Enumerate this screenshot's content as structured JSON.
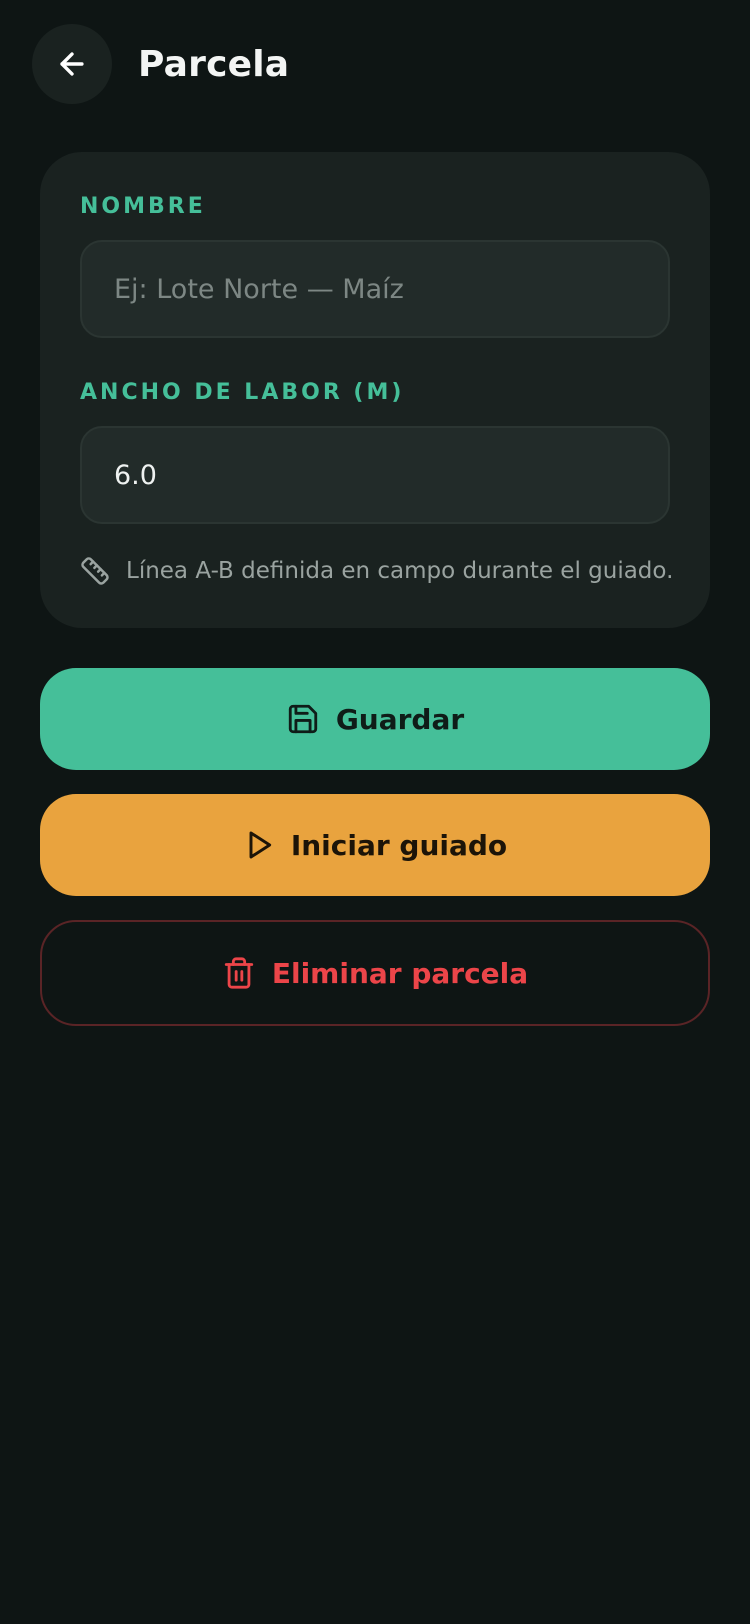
{
  "header": {
    "title": "Parcela",
    "back_icon": "arrow-left-icon"
  },
  "form": {
    "name_label": "NOMBRE",
    "name_value": "",
    "name_placeholder": "Ej: Lote Norte — Maíz",
    "width_label": "ANCHO DE LABOR (M)",
    "width_value": "6.0",
    "hint_icon": "ruler-icon",
    "hint_text": "Línea A-B definida en campo durante el guiado."
  },
  "actions": {
    "save_label": "Guardar",
    "save_icon": "save-icon",
    "guide_label": "Iniciar guiado",
    "guide_icon": "play-icon",
    "delete_label": "Eliminar parcela",
    "delete_icon": "trash-icon"
  },
  "colors": {
    "background": "#0e1514",
    "card": "#1a2220",
    "accent_green": "#45bf99",
    "accent_orange": "#e9a33e",
    "danger_red": "#ec4549"
  }
}
